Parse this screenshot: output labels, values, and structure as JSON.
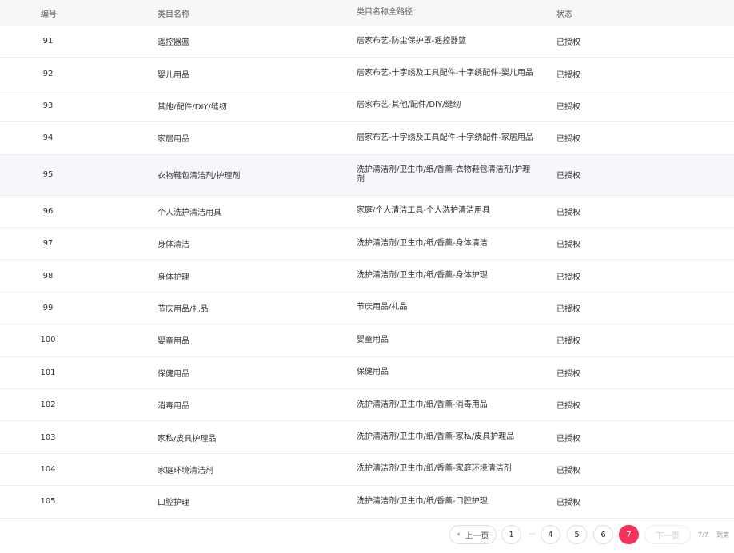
{
  "table": {
    "headers": {
      "id": "编号",
      "name": "类目名称",
      "path": "类目名称全路径",
      "status": "状态"
    },
    "rows": [
      {
        "id": "91",
        "name": "遥控器篮",
        "path": "居家布艺-防尘保护罩-遥控器篮",
        "status": "已授权"
      },
      {
        "id": "92",
        "name": "婴儿用品",
        "path": "居家布艺-十字绣及工具配件-十字绣配件-婴儿用品",
        "status": "已授权"
      },
      {
        "id": "93",
        "name": "其他/配件/DIY/缝纫",
        "path": "居家布艺-其他/配件/DIY/缝纫",
        "status": "已授权"
      },
      {
        "id": "94",
        "name": "家居用品",
        "path": "居家布艺-十字绣及工具配件-十字绣配件-家居用品",
        "status": "已授权"
      },
      {
        "id": "95",
        "name": "衣物鞋包清洁剂/护理剂",
        "path": "洗护清洁剂/卫生巾/纸/香薰-衣物鞋包清洁剂/护理剂",
        "status": "已授权"
      },
      {
        "id": "96",
        "name": "个人洗护清洁用具",
        "path": "家庭/个人清洁工具-个人洗护清洁用具",
        "status": "已授权"
      },
      {
        "id": "97",
        "name": "身体清洁",
        "path": "洗护清洁剂/卫生巾/纸/香薰-身体清洁",
        "status": "已授权"
      },
      {
        "id": "98",
        "name": "身体护理",
        "path": "洗护清洁剂/卫生巾/纸/香薰-身体护理",
        "status": "已授权"
      },
      {
        "id": "99",
        "name": "节庆用品/礼品",
        "path": "节庆用品/礼品",
        "status": "已授权"
      },
      {
        "id": "100",
        "name": "婴童用品",
        "path": "婴童用品",
        "status": "已授权"
      },
      {
        "id": "101",
        "name": "保健用品",
        "path": "保健用品",
        "status": "已授权"
      },
      {
        "id": "102",
        "name": "消毒用品",
        "path": "洗护清洁剂/卫生巾/纸/香薰-消毒用品",
        "status": "已授权"
      },
      {
        "id": "103",
        "name": "家私/皮具护理品",
        "path": "洗护清洁剂/卫生巾/纸/香薰-家私/皮具护理品",
        "status": "已授权"
      },
      {
        "id": "104",
        "name": "家庭环境清洁剂",
        "path": "洗护清洁剂/卫生巾/纸/香薰-家庭环境清洁剂",
        "status": "已授权"
      },
      {
        "id": "105",
        "name": "口腔护理",
        "path": "洗护清洁剂/卫生巾/纸/香薰-口腔护理",
        "status": "已授权"
      }
    ]
  },
  "pagination": {
    "prev_label": "上一页",
    "next_label": "下一页",
    "ellipsis": "···",
    "pages": [
      "1",
      "4",
      "5",
      "6",
      "7"
    ],
    "current_page": "7",
    "page_info": "7/7",
    "jump_label": "到第"
  },
  "colors": {
    "accent": "#f5335a",
    "header_bg": "#f7f7f8",
    "hover_row_bg": "#f6f7fb",
    "border": "#eeeeee"
  },
  "icons": {
    "prev": "chevron-left-icon"
  }
}
